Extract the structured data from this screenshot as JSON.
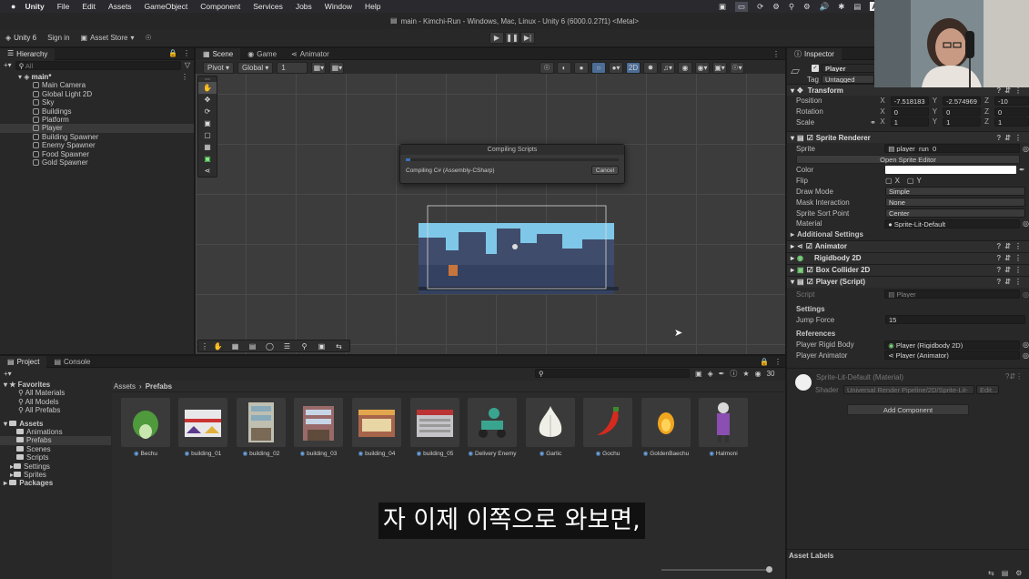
{
  "menubar": {
    "apple": "",
    "items": [
      "Unity",
      "File",
      "Edit",
      "Assets",
      "GameObject",
      "Component",
      "Services",
      "Jobs",
      "Window",
      "Help"
    ]
  },
  "window_title": "main - Kimchi-Run - Windows, Mac, Linux - Unity 6 (6000.0.27f1) <Metal>",
  "toolbar": {
    "unity_label": "Unity 6",
    "sign_in": "Sign in",
    "asset_store": "Asset Store"
  },
  "hierarchy": {
    "tab": "Hierarchy",
    "search_placeholder": "All",
    "scene": "main*",
    "items": [
      "Main Camera",
      "Global Light 2D",
      "Sky",
      "Buildings",
      "Platform",
      "Player",
      "Building Spawner",
      "Enemy Spawner",
      "Food Spawner",
      "Gold Spawner"
    ],
    "selected": "Player"
  },
  "scene_tabs": [
    "Scene",
    "Game",
    "Animator"
  ],
  "scene_toolbar": {
    "pivot": "Pivot",
    "global": "Global",
    "snap": "1",
    "mode_2d": "2D"
  },
  "dialog": {
    "title": "Compiling Scripts",
    "message": "Compiling C# (Assembly-CSharp)",
    "cancel": "Cancel",
    "progress": 0.02
  },
  "inspector": {
    "tab": "Inspector",
    "object_name": "Player",
    "tag_label": "Tag",
    "tag_value": "Untagged",
    "transform": {
      "title": "Transform",
      "position_label": "Position",
      "position": [
        "-7.518183",
        "-2.574969",
        "-10"
      ],
      "rotation_label": "Rotation",
      "rotation": [
        "0",
        "0",
        "0"
      ],
      "scale_label": "Scale",
      "scale": [
        "1",
        "1",
        "1"
      ]
    },
    "sprite_renderer": {
      "title": "Sprite Renderer",
      "sprite_label": "Sprite",
      "sprite_value": "player_run_0",
      "open_editor": "Open Sprite Editor",
      "color_label": "Color",
      "flip_label": "Flip",
      "flip_x": "X",
      "flip_y": "Y",
      "draw_mode_label": "Draw Mode",
      "draw_mode": "Simple",
      "mask_label": "Mask Interaction",
      "mask": "None",
      "sort_point_label": "Sprite Sort Point",
      "sort_point": "Center",
      "material_label": "Material",
      "material": "Sprite-Lit-Default",
      "additional": "Additional Settings"
    },
    "components": [
      "Animator",
      "Rigidbody 2D",
      "Box Collider 2D",
      "Player (Script)"
    ],
    "script_label": "Script",
    "script_value": "Player",
    "settings_header": "Settings",
    "jump_force_label": "Jump Force",
    "jump_force": "15",
    "references_header": "References",
    "rigid_body_label": "Player Rigid Body",
    "rigid_body_value": "Player (Rigidbody 2D)",
    "animator_label": "Player Animator",
    "animator_value": "Player (Animator)",
    "material_name": "Sprite-Lit-Default (Material)",
    "shader_label": "Shader",
    "shader_value": "Universal Render Pipeline/2D/Sprite-Lit-",
    "shader_edit": "Edit...",
    "add_component": "Add Component",
    "asset_labels": "Asset Labels"
  },
  "project": {
    "tabs": [
      "Project",
      "Console"
    ],
    "favorites": "Favorites",
    "favorite_items": [
      "All Materials",
      "All Models",
      "All Prefabs"
    ],
    "assets": "Assets",
    "asset_folders": [
      "Animations",
      "Prefabs",
      "Scenes",
      "Scripts",
      "Settings",
      "Sprites"
    ],
    "packages": "Packages",
    "breadcrumb": [
      "Assets",
      "Prefabs"
    ],
    "count": "30",
    "items": [
      "Bechu",
      "building_01",
      "building_02",
      "building_03",
      "building_04",
      "building_05",
      "Delivery Enemy",
      "Garlic",
      "Gochu",
      "GoldenBaechu",
      "Halmoni"
    ]
  },
  "subtitle": "자 이제 이쪽으로 와보면,",
  "colors": {
    "accent": "#3d6fb6",
    "panel": "#282828",
    "selected": "#3a3a3a"
  }
}
